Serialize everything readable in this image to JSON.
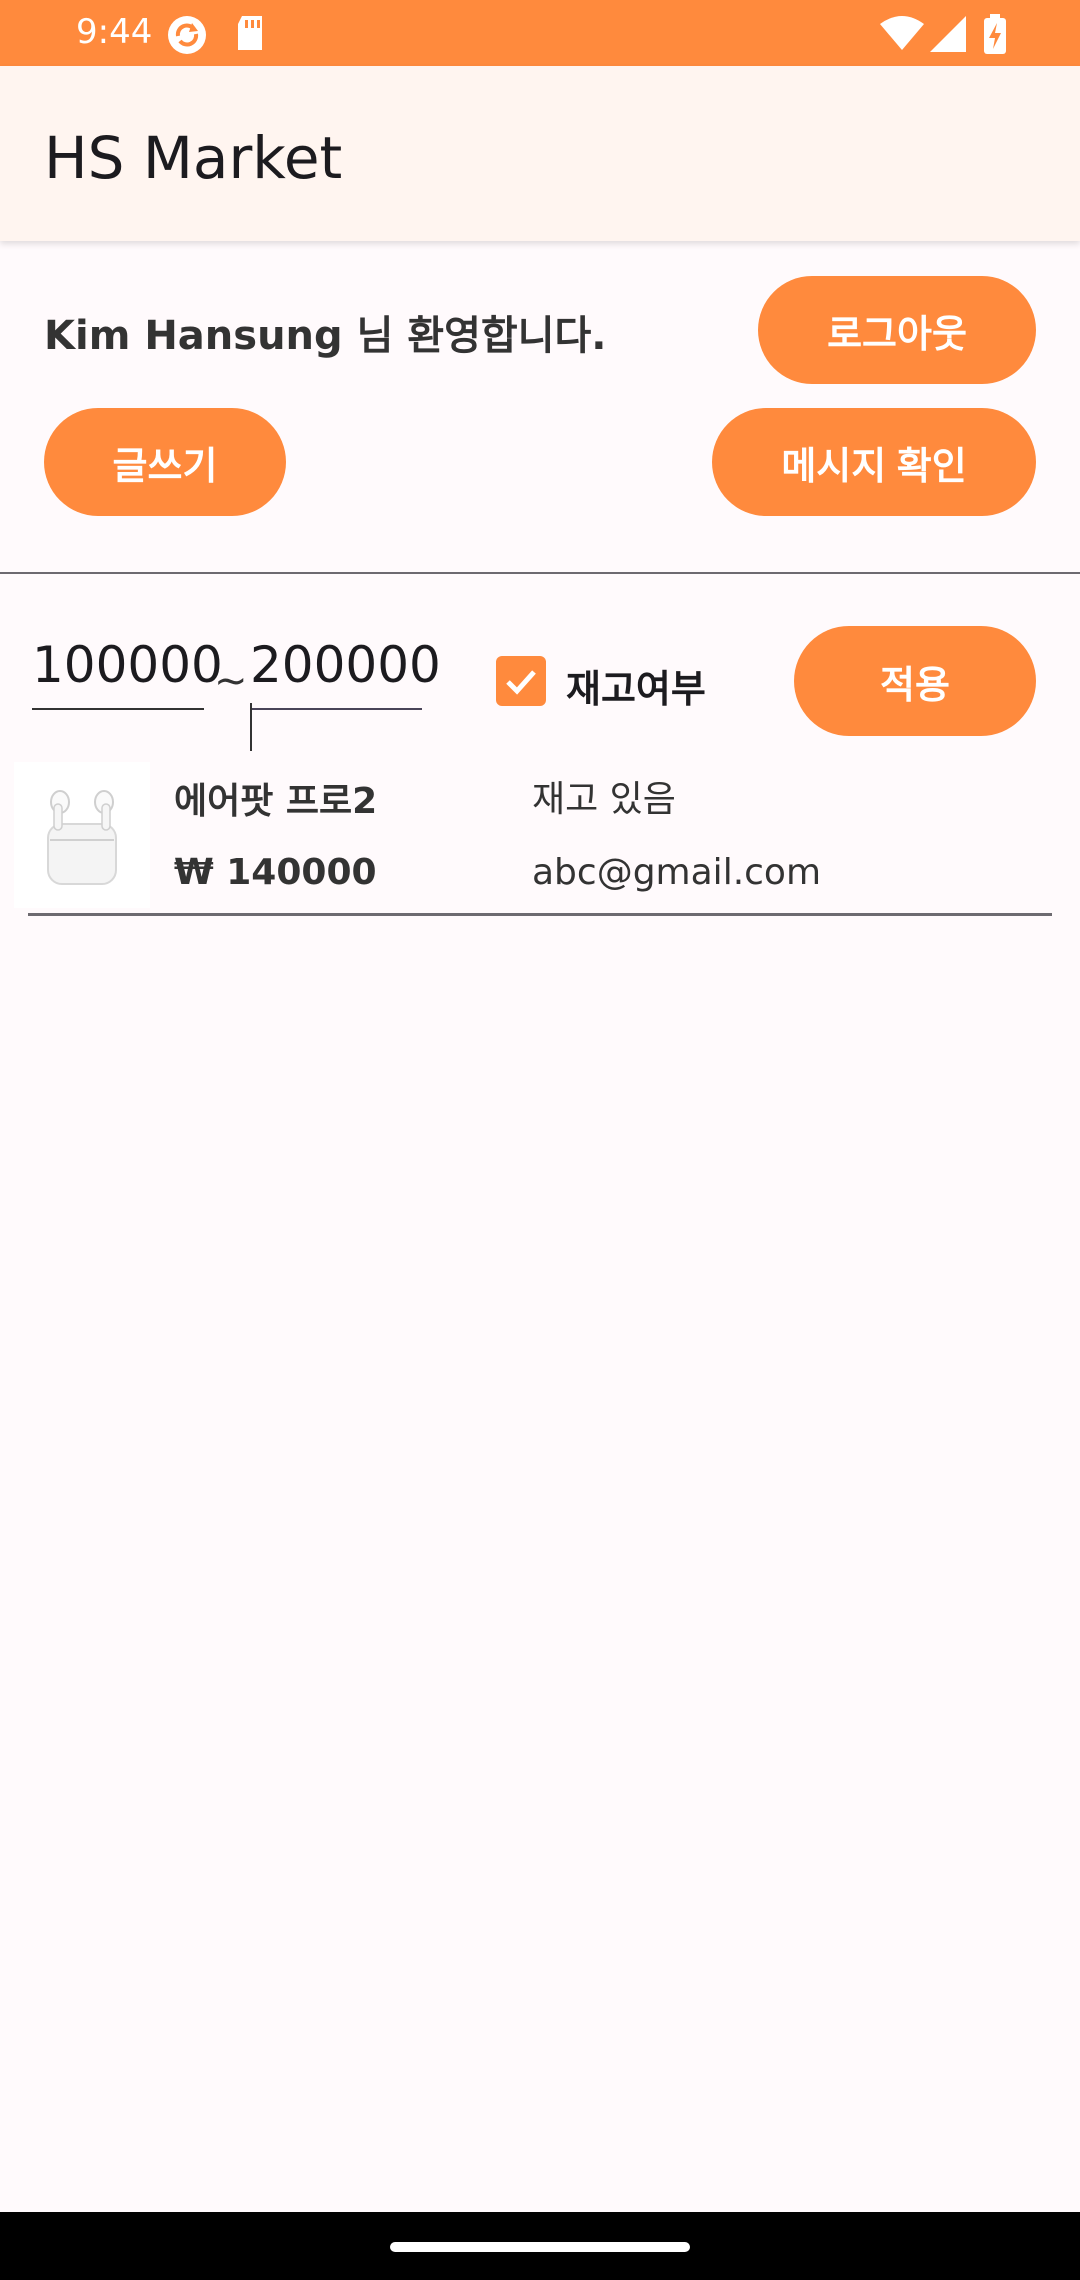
{
  "status_bar": {
    "time": "9:44",
    "icons": [
      "sync-icon",
      "sd-card-icon",
      "wifi-icon",
      "signal-icon",
      "battery-charging-icon"
    ]
  },
  "app_bar": {
    "title": "HS Market"
  },
  "user_section": {
    "welcome_text": "Kim Hansung 님 환영합니다.",
    "logout_label": "로그아웃",
    "write_label": "글쓰기",
    "messages_label": "메시지 확인"
  },
  "filter": {
    "min_price": "100000",
    "separator": "~",
    "max_price": "200000",
    "in_stock_checked": true,
    "in_stock_label": "재고여부",
    "apply_label": "적용"
  },
  "products": [
    {
      "image_icon": "airpods-image",
      "name": "에어팟 프로2",
      "price": "₩ 140000",
      "stock": "재고 있음",
      "seller": "abc@gmail.com"
    }
  ],
  "colors": {
    "accent": "#ff8a3d",
    "app_bar_bg": "#fff5f0",
    "page_bg": "#fffafc"
  }
}
